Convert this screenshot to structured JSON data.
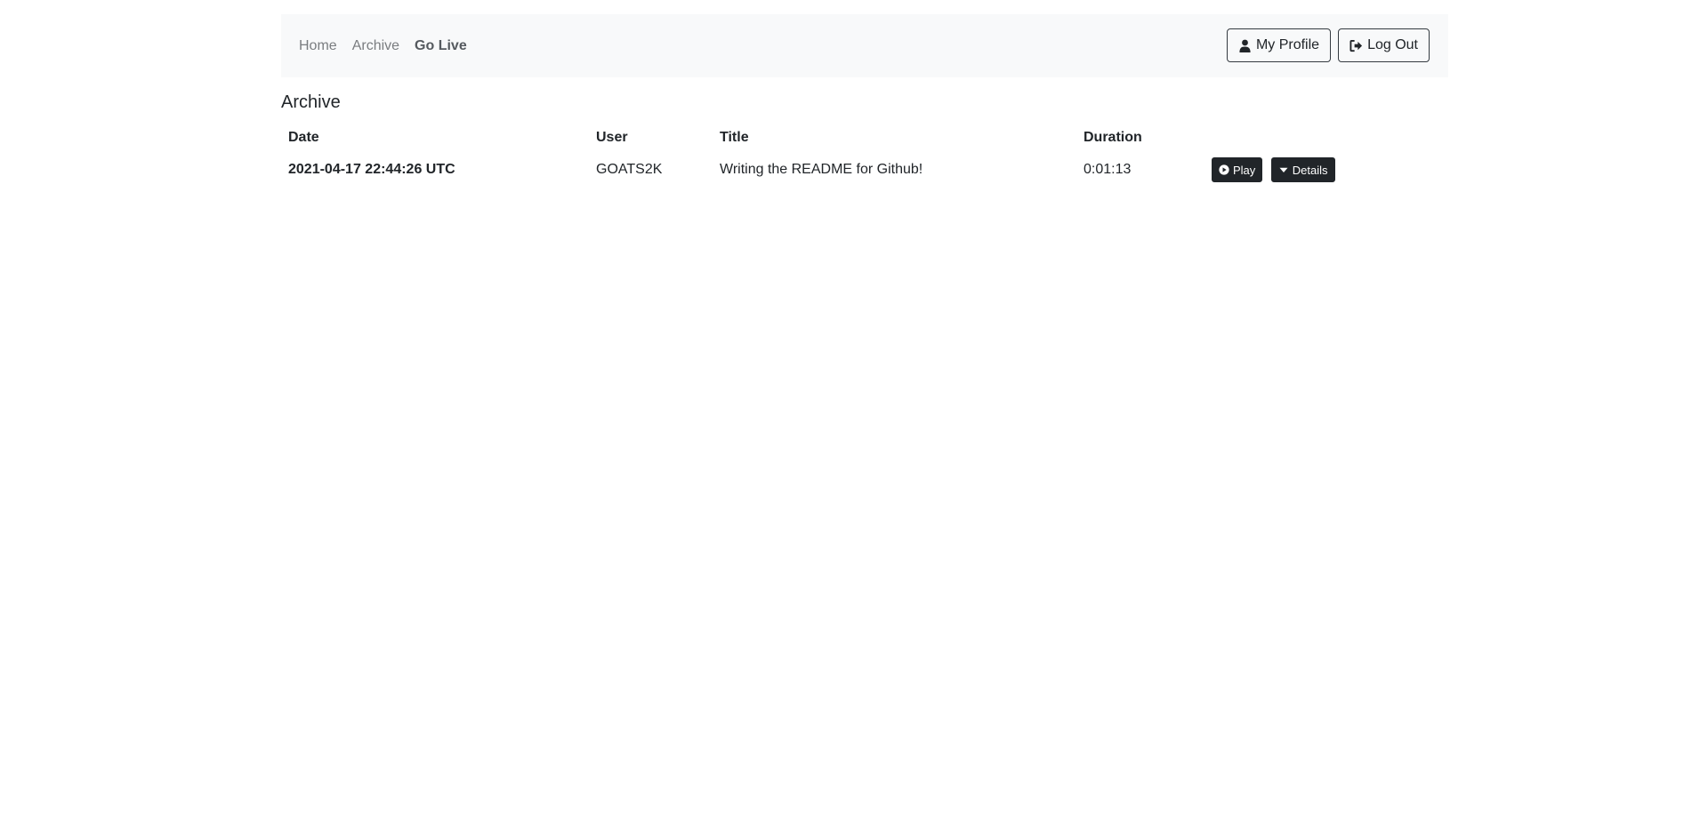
{
  "nav": {
    "links": [
      {
        "label": "Home"
      },
      {
        "label": "Archive"
      },
      {
        "label": "Go Live"
      }
    ],
    "profile_label": "My Profile",
    "logout_label": "Log Out",
    "icons": {
      "profile": "user-icon",
      "logout": "sign-out-icon"
    }
  },
  "page": {
    "title": "Archive"
  },
  "table": {
    "columns": [
      "Date",
      "User",
      "Title",
      "Duration"
    ],
    "rows": [
      {
        "date": "2021-04-17 22:44:26 UTC",
        "user": "GOATS2K",
        "title": "Writing the README for Github!",
        "duration": "0:01:13",
        "play_label": "Play",
        "details_label": "Details"
      }
    ]
  },
  "colors": {
    "navbar_bg": "#f8f9fa",
    "button_dark": "#212529",
    "text": "#212529"
  }
}
